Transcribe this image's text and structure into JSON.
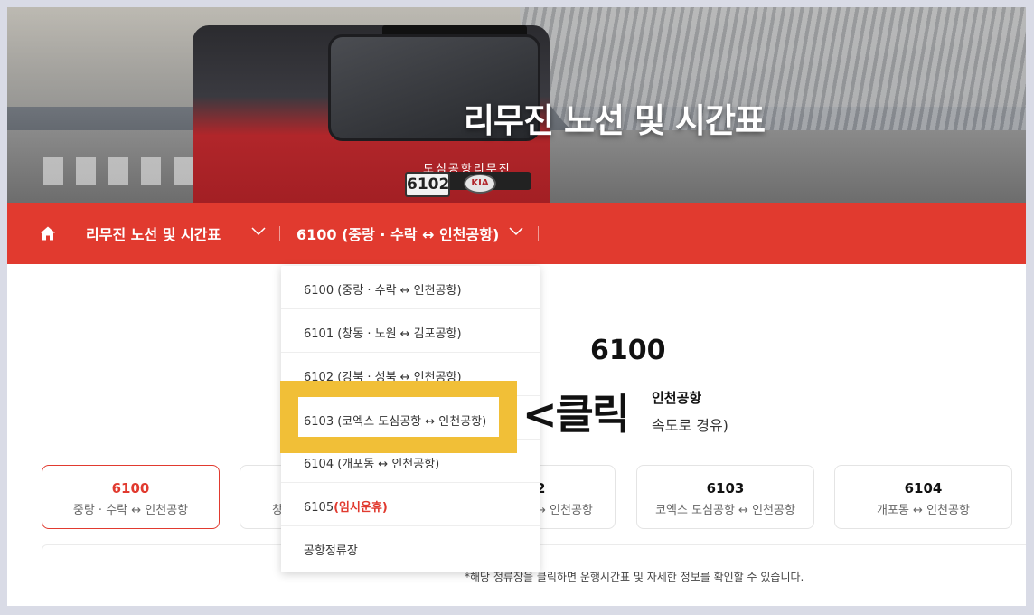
{
  "hero": {
    "title": "리무진 노선 및 시간표",
    "bus_text": "도심공항리무진",
    "bus_plate": "6102",
    "bus_brand": "KIA"
  },
  "nav": {
    "breadcrumb_1": "리무진 노선 및 시간표",
    "breadcrumb_2": "6100 (중랑 · 수락 ↔ 인천공항)"
  },
  "dropdown": {
    "items": [
      {
        "label": "6100 (중랑 · 수락 ↔ 인천공항)"
      },
      {
        "label": "6101 (창동 · 노원 ↔ 김포공항)"
      },
      {
        "label": "6102 (강북 · 성북 ↔ 인천공항)"
      },
      {
        "label": "6103 (코엑스 도심공항 ↔ 인천공항)"
      },
      {
        "label": "6104 (개포동 ↔ 인천공항)"
      },
      {
        "label_prefix": "6105",
        "label_suffix": "(임시운휴)"
      },
      {
        "label": "공항정류장"
      }
    ]
  },
  "annotation": {
    "text": "<클릭"
  },
  "route": {
    "number": "6100",
    "subtitle_1": "인천공항",
    "subtitle_2": "속도로 경유)"
  },
  "cards": [
    {
      "num": "6100",
      "name": "중랑 · 수락 ↔ 인천공항"
    },
    {
      "num": "",
      "name": "창"
    },
    {
      "num": "2",
      "name": "↔ 인천공항"
    },
    {
      "num": "6103",
      "name": "코엑스 도심공항 ↔ 인천공항"
    },
    {
      "num": "6104",
      "name": "개포동 ↔ 인천공항"
    }
  ],
  "notice": "*해당 정류장을 클릭하면 운행시간표 및 자세한 정보를 확인할 수 있습니다.",
  "colors": {
    "accent": "#e13a2f",
    "highlight": "#f1bf37"
  }
}
